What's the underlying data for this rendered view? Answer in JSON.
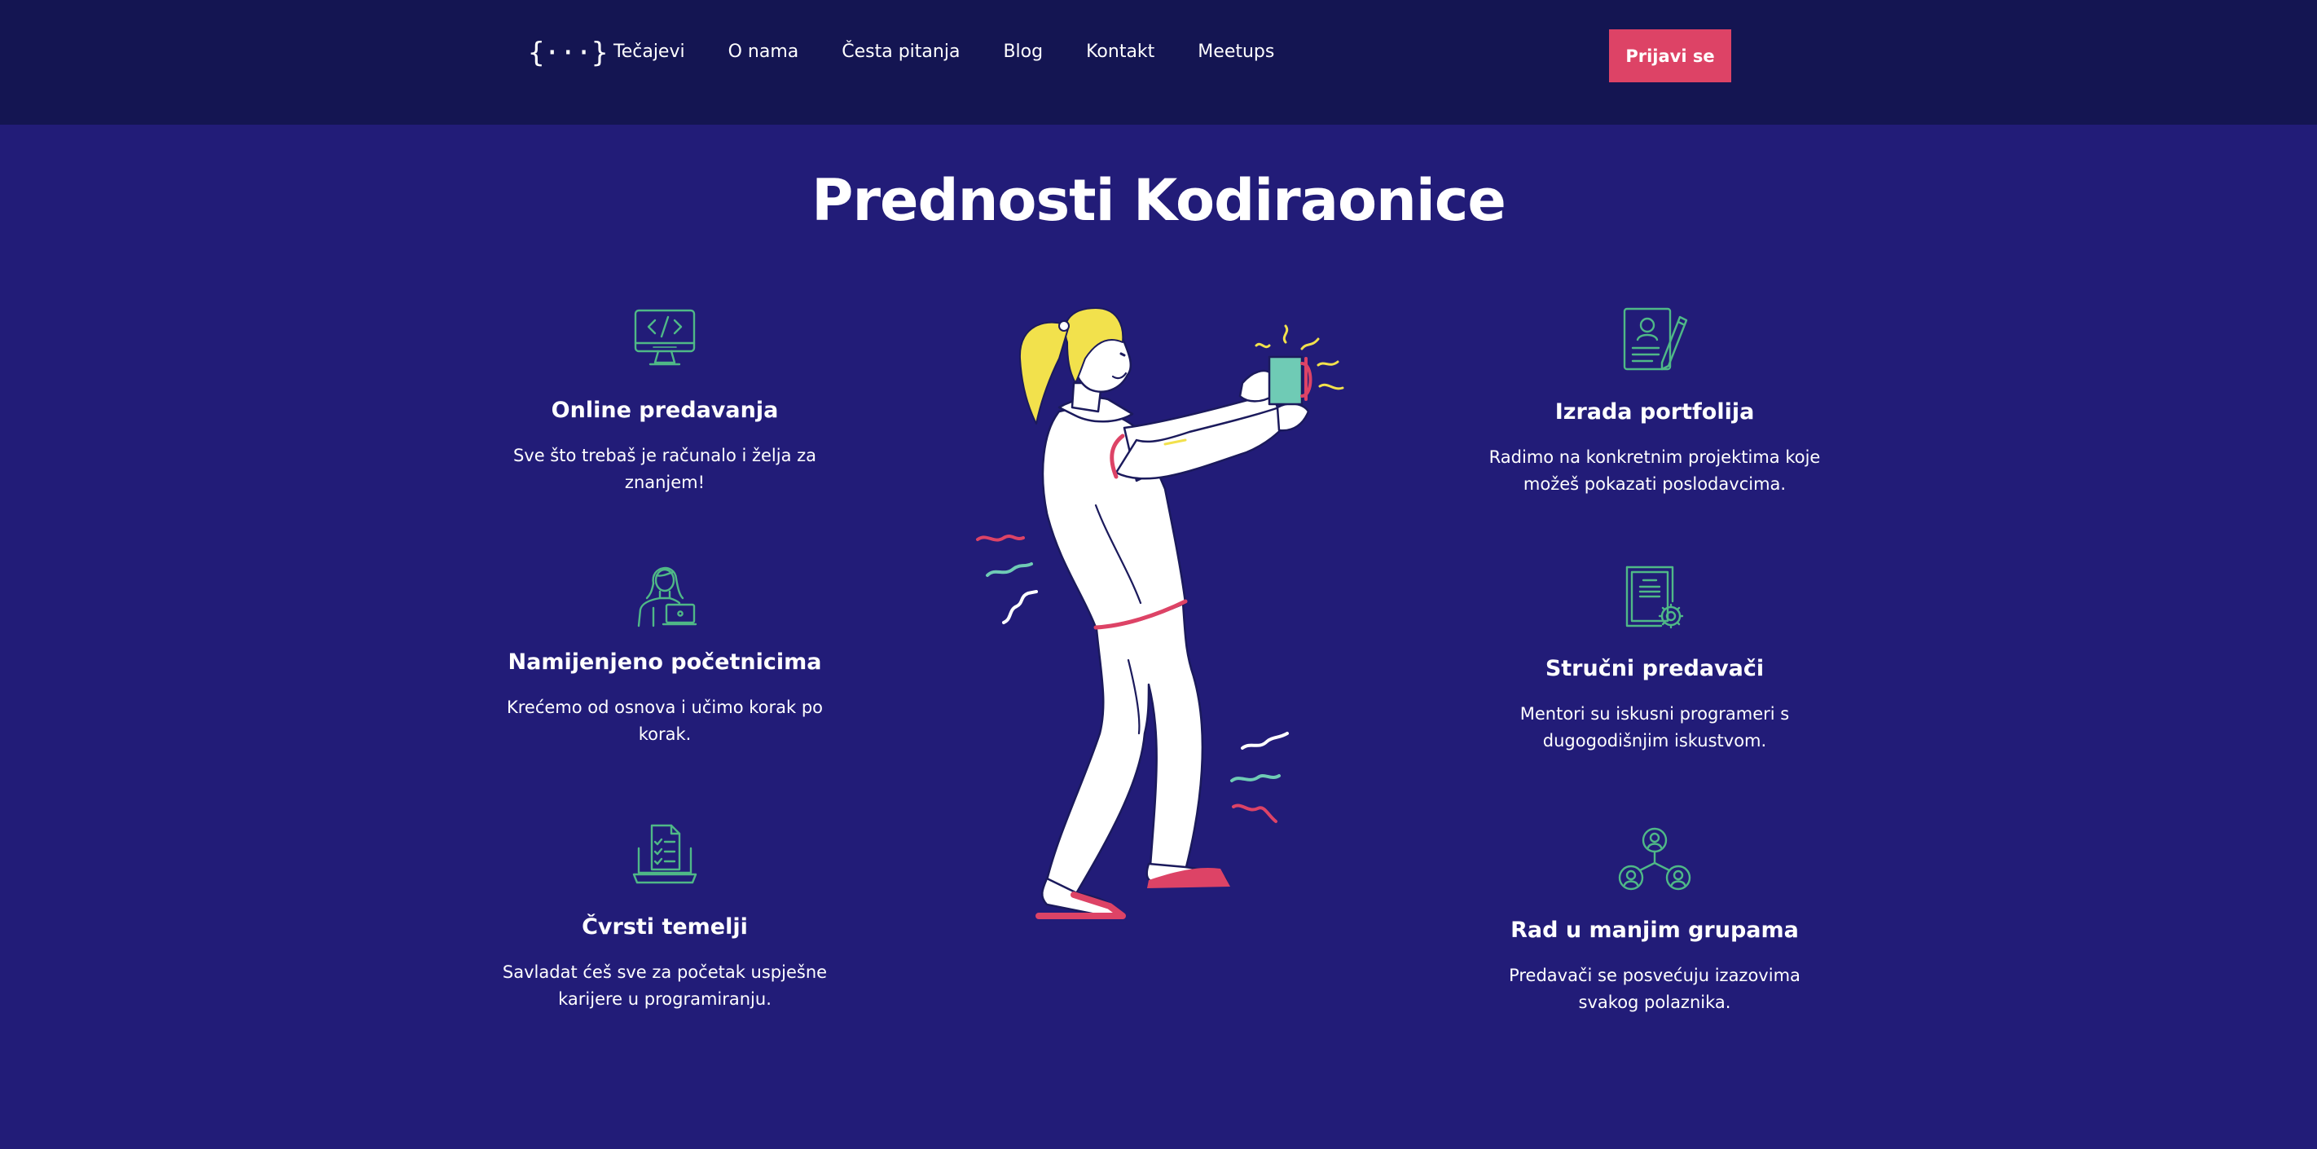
{
  "nav": {
    "logo": "{···}",
    "links": [
      "Tečajevi",
      "O nama",
      "Česta pitanja",
      "Blog",
      "Kontakt",
      "Meetups"
    ],
    "signin_label": "Prijavi se"
  },
  "section": {
    "title": "Prednosti Kodiraonice"
  },
  "features": [
    {
      "icon": "monitor-code-icon",
      "title": "Online predavanja",
      "text": "Sve što trebaš je računalo i želja za znanjem!"
    },
    {
      "icon": "woman-laptop-icon",
      "title": "Namijenjeno početnicima",
      "text": "Krećemo od osnova i učimo korak po korak."
    },
    {
      "icon": "laptop-checklist-icon",
      "title": "Čvrsti temelji",
      "text": "Savladat ćeš sve za početak uspješne karijere u programiranju."
    },
    {
      "icon": "resume-pencil-icon",
      "title": "Izrada portfolija",
      "text": "Radimo na konkretnim projektima koje možeš pokazati poslodavcima."
    },
    {
      "icon": "certificate-icon",
      "title": "Stručni predavači",
      "text": "Mentori su iskusni programeri s dugogodišnjim iskustvom."
    },
    {
      "icon": "group-network-icon",
      "title": "Rad u manjim grupama",
      "text": "Predavači se posvećuju izazovima svakog polaznika."
    }
  ],
  "colors": {
    "header_bg": "#141552",
    "page_bg": "#221c78",
    "accent": "#dd4366",
    "icon": "#4fb887",
    "hair": "#f2e14c",
    "mug": "#6fcbb5"
  }
}
